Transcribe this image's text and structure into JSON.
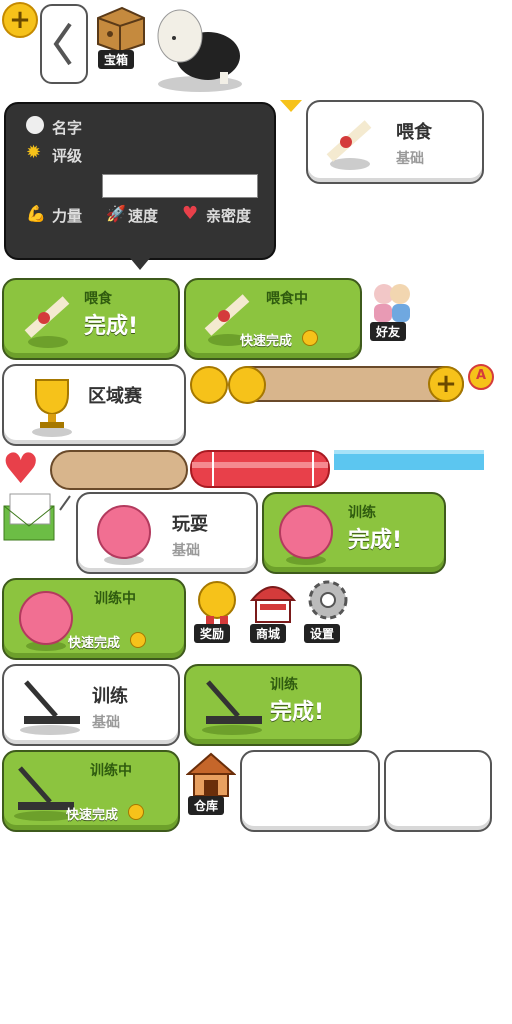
{
  "top": {
    "chest_tag": "宝箱"
  },
  "stats_panel": {
    "name_label": "名字",
    "rating_label": "评级",
    "strength_label": "力量",
    "speed_label": "速度",
    "affinity_label": "亲密度"
  },
  "feed_basic": {
    "title": "喂食",
    "subtitle": "基础"
  },
  "feed_done": {
    "title": "喂食",
    "status": "完成!"
  },
  "feed_in_progress": {
    "title": "喂食中",
    "quick": "快速完成"
  },
  "friends_tag": "好友",
  "tournament_label": "区域赛",
  "badge_letter": "A",
  "play_basic": {
    "title": "玩耍",
    "subtitle": "基础"
  },
  "train_done_ball": {
    "title": "训练",
    "status": "完成!"
  },
  "train_in_progress_ball": {
    "title": "训练中",
    "quick": "快速完成"
  },
  "icons": {
    "reward": "奖励",
    "shop": "商城",
    "settings": "设置",
    "warehouse": "仓库"
  },
  "train_basic": {
    "title": "训练",
    "subtitle": "基础"
  },
  "train_done_tread": {
    "title": "训练",
    "status": "完成!"
  },
  "train_in_progress_tread": {
    "title": "训练中",
    "quick": "快速完成"
  },
  "colors": {
    "green": "#8cc43f",
    "dark_panel": "#333333",
    "red_bar": "#e8404a",
    "blue_bar": "#5cc6f0"
  }
}
